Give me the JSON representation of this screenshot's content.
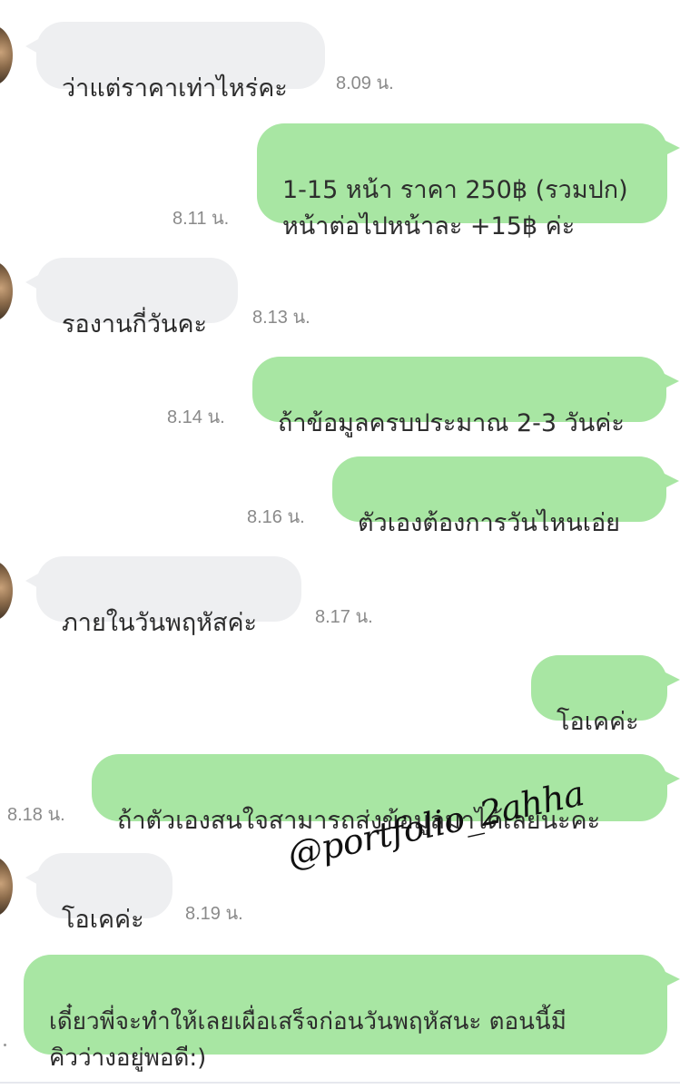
{
  "messages": [
    {
      "side": "in",
      "text": "ว่าแต่ราคาเท่าไหร่คะ",
      "time": "8.09 น."
    },
    {
      "side": "out",
      "text": "1-15 หน้า ราคา 250฿ (รวมปก)\nหน้าต่อไปหน้าละ +15฿ ค่ะ",
      "time": "8.11 น."
    },
    {
      "side": "in",
      "text": "รองานกี่วันคะ",
      "time": "8.13 น."
    },
    {
      "side": "out",
      "text": "ถ้าข้อมูลครบประมาณ 2-3 วันค่ะ",
      "time": "8.14 น."
    },
    {
      "side": "out",
      "text": "ตัวเองต้องการวันไหนเอ่ย",
      "time": "8.16 น."
    },
    {
      "side": "in",
      "text": "ภายในวันพฤหัสค่ะ",
      "time": "8.17 น."
    },
    {
      "side": "out",
      "text": "โอเคค่ะ",
      "time": ""
    },
    {
      "side": "out",
      "text": "ถ้าตัวเองสนใจสามารถส่งข้อมูลมาได้เลยนะคะ",
      "time": "8.18 น."
    },
    {
      "side": "in",
      "text": "โอเคค่ะ",
      "time": "8.19 น."
    },
    {
      "side": "out",
      "text": "เดี๋ยวพี่จะทำให้เลยเผื่อเสร็จก่อนวันพฤหัสนะ ตอนนี้มี\nคิวว่างอยู่พอดี:)",
      "time": ""
    }
  ],
  "watermark": "@portfolio_2ahha",
  "colors": {
    "incoming_bubble": "#eeeff1",
    "outgoing_bubble": "#a8e6a3",
    "timestamp": "#8a8a8a"
  }
}
